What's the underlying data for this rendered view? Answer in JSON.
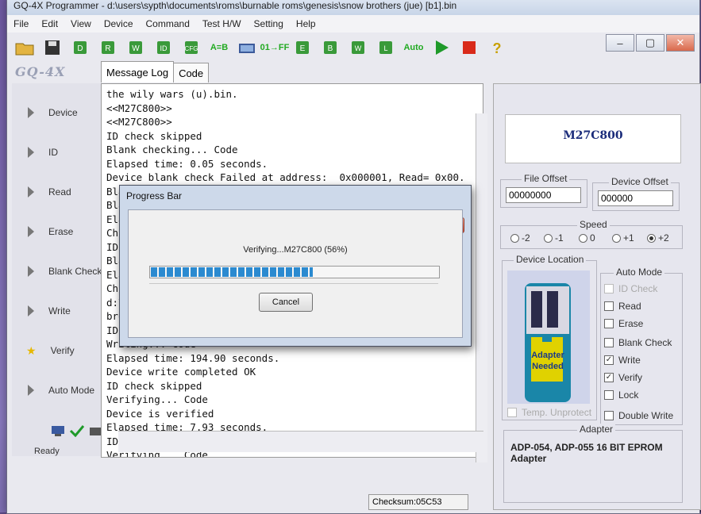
{
  "window": {
    "title": "GQ-4X Programmer - d:\\users\\sypth\\documents\\roms\\burnable roms\\genesis\\snow brothers (jue) [b1].bin",
    "controls": [
      "–",
      "▢",
      "✕"
    ]
  },
  "menu": [
    "File",
    "Edit",
    "View",
    "Device",
    "Command",
    "Test H/W",
    "Setting",
    "Help"
  ],
  "toolbar": {
    "labels": [
      "A=B",
      "01→FF",
      "Auto"
    ]
  },
  "brand": "GQ-4X",
  "tabs": [
    "Message Log",
    "Code"
  ],
  "sidebar": {
    "items": [
      "Device",
      "ID",
      "Read",
      "Erase",
      "Blank Check",
      "Write",
      "Verify",
      "Auto Mode"
    ],
    "status": "Ready"
  },
  "log": {
    "lines": [
      "the wily wars (u).bin.",
      "<<M27C800>>",
      "<<M27C800>>",
      "ID check skipped",
      "Blank checking... Code",
      "Elapsed time: 0.05 seconds.",
      "Device blank check Failed at address:  0x000001, Read= 0x00.",
      "Blank check failed",
      "Bla",
      "Ela",
      "Chi",
      "ID",
      "Bla",
      "Ela",
      "Chi",
      "d:\\",
      "bro",
      "ID check skipped",
      "Writing... Code",
      "Elapsed time: 194.90 seconds.",
      "Device write completed OK",
      "ID check skipped",
      "Verifying... Code",
      "Device is verified",
      "Elapsed time: 7.93 seconds.",
      "ID check skipped",
      "Verifying... Code"
    ]
  },
  "checksum": "Checksum:05C53",
  "right_panel": {
    "chip": "M27C800",
    "file_offset": {
      "label": "File Offset",
      "value": "00000000"
    },
    "device_offset": {
      "label": "Device Offset",
      "value": "000000"
    },
    "speed": {
      "label": "Speed",
      "options": [
        "-2",
        "-1",
        "0",
        "+1",
        "+2"
      ],
      "selected": "+2"
    },
    "device_location": {
      "label": "Device Location",
      "adapter_text": "Adapter Needed",
      "temp_unprotect": "Temp. Unprotect"
    },
    "auto_mode": {
      "label": "Auto Mode",
      "options": [
        {
          "label": "ID Check",
          "checked": false,
          "enabled": false
        },
        {
          "label": "Read",
          "checked": false,
          "enabled": true
        },
        {
          "label": "Erase",
          "checked": false,
          "enabled": true
        },
        {
          "label": "Blank Check",
          "checked": false,
          "enabled": true
        },
        {
          "label": "Write",
          "checked": true,
          "enabled": true
        },
        {
          "label": "Verify",
          "checked": true,
          "enabled": true
        },
        {
          "label": "Lock",
          "checked": false,
          "enabled": true
        }
      ],
      "double_write": "Double Write"
    },
    "adapter": {
      "label": "Adapter",
      "text": "ADP-054, ADP-055 16 BIT EPROM Adapter"
    }
  },
  "progress_dialog": {
    "title": "Progress Bar",
    "message": "Verifying...M27C800 (56%)",
    "progress": 0.56,
    "cancel": "Cancel",
    "close": "✕"
  }
}
